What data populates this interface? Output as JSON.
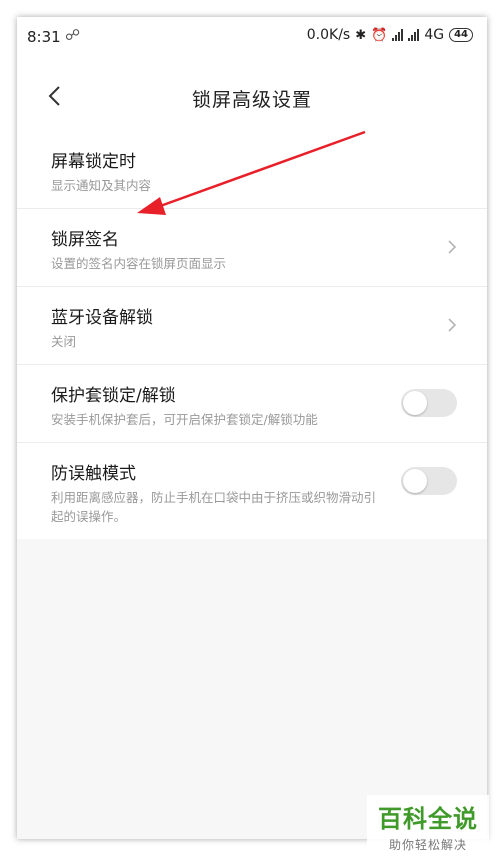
{
  "status_bar": {
    "time": "8:31",
    "left_icon": "notification-icon",
    "network_speed": "0.0K/s",
    "network_type": "4G",
    "battery": "44"
  },
  "header": {
    "title": "锁屏高级设置",
    "back_icon": "chevron-left-icon"
  },
  "settings": [
    {
      "title": "屏幕锁定时",
      "subtitle": "显示通知及其内容",
      "control": "none"
    },
    {
      "title": "锁屏签名",
      "subtitle": "设置的签名内容在锁屏页面显示",
      "control": "chevron"
    },
    {
      "title": "蓝牙设备解锁",
      "subtitle": "关闭",
      "control": "chevron"
    },
    {
      "title": "保护套锁定/解锁",
      "subtitle": "安装手机保护套后，可开启保护套锁定/解锁功能",
      "control": "toggle",
      "on": false
    },
    {
      "title": "防误触模式",
      "subtitle": "利用距离感应器，防止手机在口袋中由于挤压或织物滑动引起的误操作。",
      "control": "toggle",
      "on": false
    }
  ],
  "annotation": {
    "color": "#e8202a"
  },
  "watermark": {
    "main": "百科全说",
    "sub": "助你轻松解决",
    "color": "#3f9a2a"
  }
}
